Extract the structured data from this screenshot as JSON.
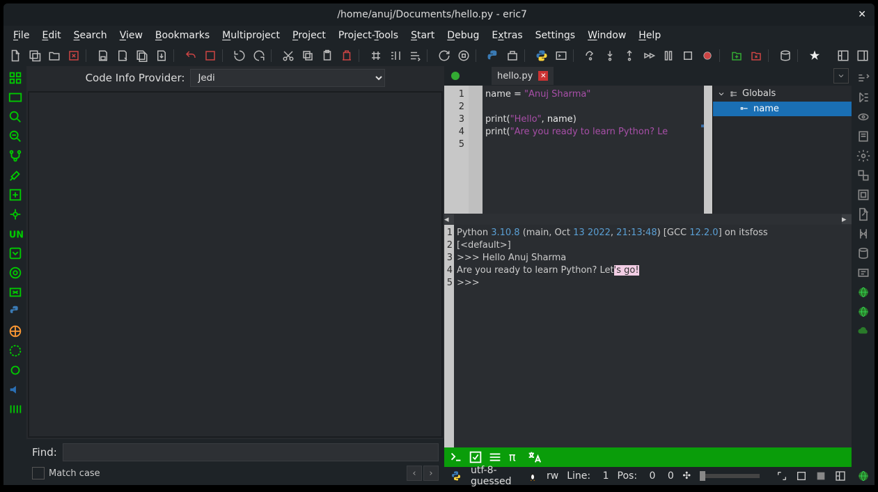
{
  "window": {
    "title": "/home/anuj/Documents/hello.py - eric7"
  },
  "menus": {
    "file": "File",
    "edit": "Edit",
    "search": "Search",
    "view": "View",
    "bookmarks": "Bookmarks",
    "multiproject": "Multiproject",
    "project": "Project",
    "projecttools": "Project-Tools",
    "start": "Start",
    "debug": "Debug",
    "extras": "Extras",
    "settings": "Settings",
    "window": "Window",
    "help": "Help"
  },
  "infoprov": {
    "label": "Code Info Provider:",
    "value": "Jedi"
  },
  "find": {
    "label": "Find:",
    "value": "",
    "matchcase": "Match case"
  },
  "tab": {
    "name": "hello.py"
  },
  "editor": {
    "lines": [
      "1",
      "2",
      "3",
      "4",
      "5"
    ],
    "l1_var": "name",
    "l1_eq": " = ",
    "l1_str": "\"Anuj Sharma\"",
    "l3_fn": "print",
    "l3_p1": "(",
    "l3_str": "\"Hello\"",
    "l3_c": ", ",
    "l3_v": "name",
    "l3_p2": ")",
    "l4_fn": "print",
    "l4_p1": "(",
    "l4_str": "\"Are you ready to learn Python? Le"
  },
  "outline": {
    "hdr": "Globals",
    "item": "name"
  },
  "console": {
    "lines": [
      "1",
      "2",
      "3",
      "4",
      "5"
    ],
    "l1a": "Python ",
    "l1b": "3.10.8",
    "l1c": " (main, Oct ",
    "l1d": "13",
    "l1e": " ",
    "l1f": "2022",
    "l1g": ", ",
    "l1h": "21",
    "l1i": ":",
    "l1j": "13",
    "l1k": ":",
    "l1l": "48",
    "l1m": ") [GCC ",
    "l1n": "12.2.0",
    "l1o": "] on itsfoss",
    "l2": "[<default>]",
    "l3": ">>> Hello Anuj Sharma",
    "l4a": "Are you ready to learn Python? Let",
    "l4b": "'s go!",
    "l5": ">>> "
  },
  "status": {
    "enc": "utf-8-guessed",
    "mode": "rw",
    "linelbl": "Line:",
    "line": "1",
    "poslbl": "Pos:",
    "pos": "0",
    "zero": "0"
  }
}
